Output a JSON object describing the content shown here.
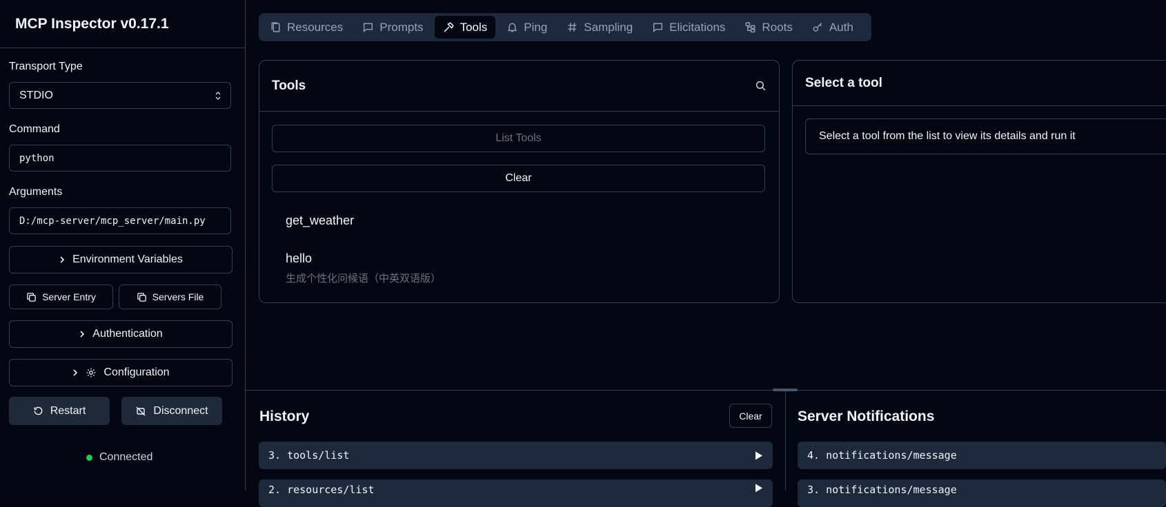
{
  "app": {
    "title": "MCP Inspector v0.17.1"
  },
  "sidebar": {
    "transport_label": "Transport Type",
    "transport_value": "STDIO",
    "command_label": "Command",
    "command_value": "python",
    "arguments_label": "Arguments",
    "arguments_value": "D:/mcp-server/mcp_server/main.py",
    "env_vars_label": "Environment Variables",
    "server_entry_label": "Server Entry",
    "servers_file_label": "Servers File",
    "authentication_label": "Authentication",
    "configuration_label": "Configuration",
    "restart_label": "Restart",
    "disconnect_label": "Disconnect",
    "status": "Connected",
    "status_color": "#22c55e"
  },
  "tabs": [
    {
      "label": "Resources",
      "icon": "files-icon"
    },
    {
      "label": "Prompts",
      "icon": "message-square-icon"
    },
    {
      "label": "Tools",
      "icon": "hammer-icon",
      "active": true
    },
    {
      "label": "Ping",
      "icon": "bell-icon"
    },
    {
      "label": "Sampling",
      "icon": "hash-icon"
    },
    {
      "label": "Elicitations",
      "icon": "message-square-icon"
    },
    {
      "label": "Roots",
      "icon": "folder-tree-icon"
    },
    {
      "label": "Auth",
      "icon": "key-icon"
    }
  ],
  "tools_panel": {
    "title": "Tools",
    "list_tools_label": "List Tools",
    "clear_label": "Clear",
    "items": [
      {
        "name": "get_weather",
        "description": ""
      },
      {
        "name": "hello",
        "description": "生成个性化问候语（中英双语版）"
      }
    ]
  },
  "detail_panel": {
    "title": "Select a tool",
    "message": "Select a tool from the list to view its details and run it"
  },
  "history": {
    "title": "History",
    "clear_label": "Clear",
    "items": [
      "3. tools/list",
      "2. resources/list"
    ]
  },
  "notifications": {
    "title": "Server Notifications",
    "items": [
      "4. notifications/message",
      "3. notifications/message"
    ]
  }
}
